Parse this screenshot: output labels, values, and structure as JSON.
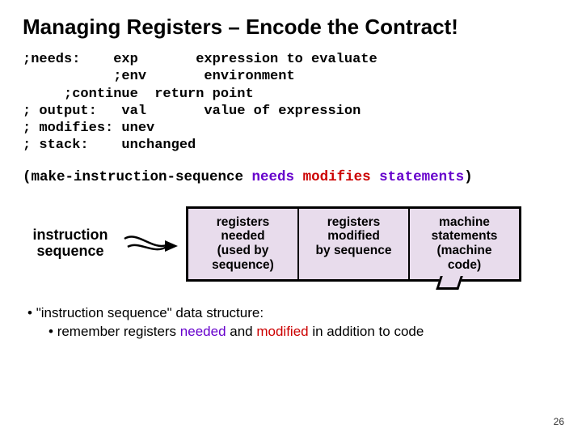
{
  "title": "Managing Registers – Encode the Contract!",
  "contract": {
    "l1a": ";needs:    exp       expression to evaluate",
    "l2a": "           ;env       environment",
    "l3a": "     ;continue  return point",
    "l4a": "; output:   val       value of expression",
    "l5a": "; modifies: unev",
    "l6a": "; stack:    unchanged"
  },
  "make": {
    "open": "(make-instruction-sequence ",
    "needs": "needs",
    "sp1": " ",
    "modifies": "modifies",
    "sp2": " ",
    "statements": "statements",
    "close": ")"
  },
  "diagram": {
    "label_l1": "instruction",
    "label_l2": "sequence",
    "box1": "registers\nneeded\n(used by\nsequence)",
    "box2": "registers\nmodified\nby sequence",
    "box3": "machine\nstatements\n(machine\ncode)"
  },
  "bullets": {
    "b1": "\"instruction sequence\" data structure:",
    "b2a": "remember registers ",
    "b2needed": "needed",
    "b2b": " and ",
    "b2mod": "modified",
    "b2c": " in addition to code"
  },
  "page": "26"
}
